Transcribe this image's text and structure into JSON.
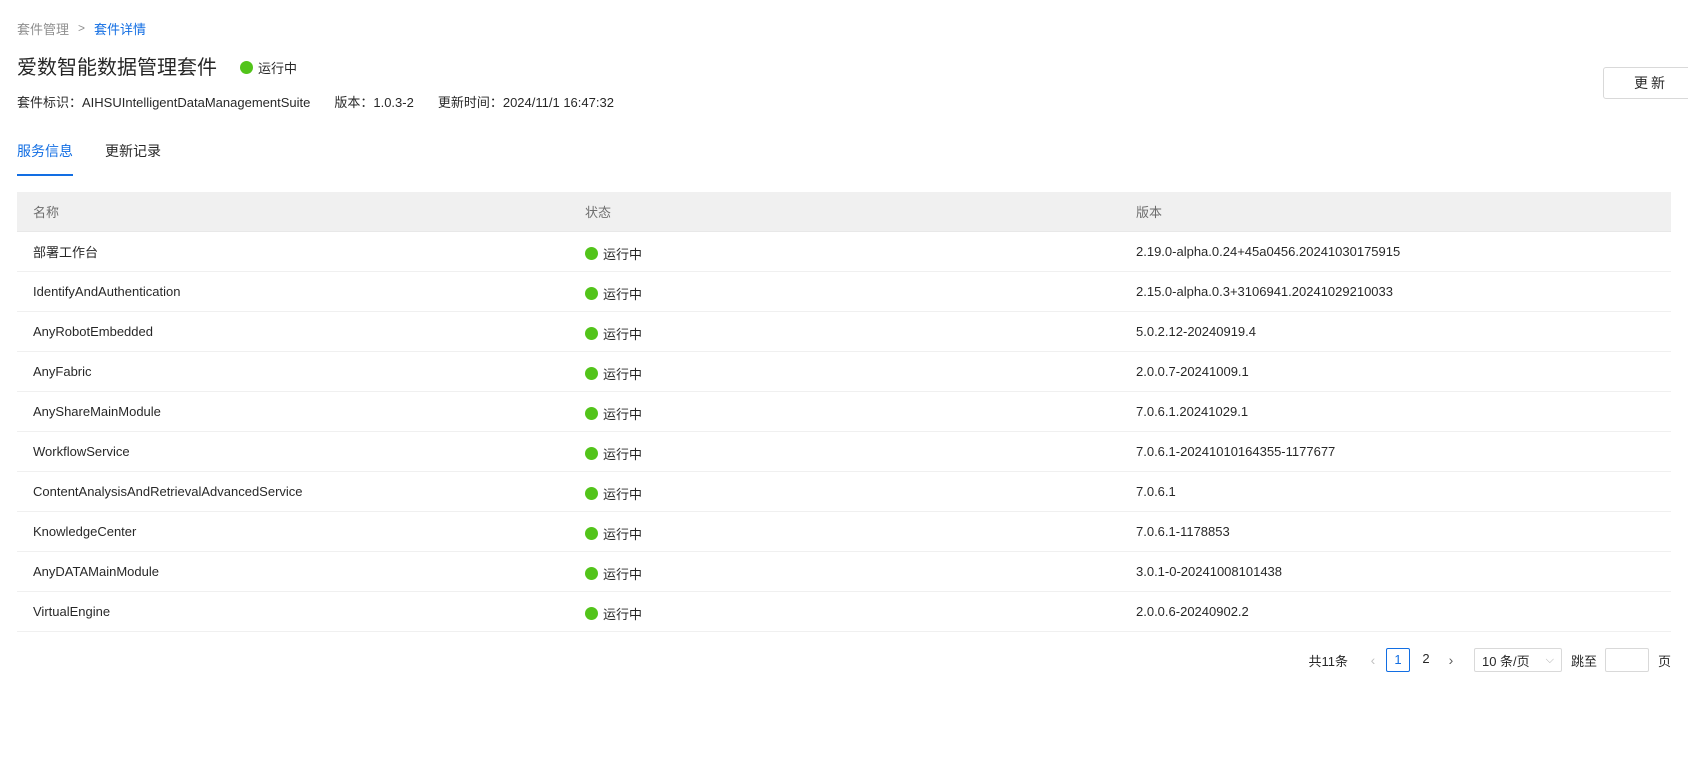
{
  "breadcrumb": {
    "parent": "套件管理",
    "separator": ">",
    "current": "套件详情"
  },
  "suite": {
    "title": "爱数智能数据管理套件",
    "status": "运行中",
    "id_label": "套件标识：AIHSUIntelligentDataManagementSuite",
    "version_label": "版本：1.0.3-2",
    "updated_label": "更新时间：2024/11/1 16:47:32"
  },
  "actions": {
    "update": "更新"
  },
  "tabs": [
    {
      "label": "服务信息",
      "active": true
    },
    {
      "label": "更新记录",
      "active": false
    }
  ],
  "table": {
    "columns": [
      "名称",
      "状态",
      "版本"
    ],
    "rows": [
      {
        "name": "部署工作台",
        "status": "运行中",
        "version": "2.19.0-alpha.0.24+45a0456.20241030175915"
      },
      {
        "name": "IdentifyAndAuthentication",
        "status": "运行中",
        "version": "2.15.0-alpha.0.3+3106941.20241029210033"
      },
      {
        "name": "AnyRobotEmbedded",
        "status": "运行中",
        "version": "5.0.2.12-20240919.4"
      },
      {
        "name": "AnyFabric",
        "status": "运行中",
        "version": "2.0.0.7-20241009.1"
      },
      {
        "name": "AnyShareMainModule",
        "status": "运行中",
        "version": "7.0.6.1.20241029.1"
      },
      {
        "name": "WorkflowService",
        "status": "运行中",
        "version": "7.0.6.1-20241010164355-1177677"
      },
      {
        "name": "ContentAnalysisAndRetrievalAdvancedService",
        "status": "运行中",
        "version": "7.0.6.1"
      },
      {
        "name": "KnowledgeCenter",
        "status": "运行中",
        "version": "7.0.6.1-1178853"
      },
      {
        "name": "AnyDATAMainModule",
        "status": "运行中",
        "version": "3.0.1-0-20241008101438"
      },
      {
        "name": "VirtualEngine",
        "status": "运行中",
        "version": "2.0.0.6-20240902.2"
      }
    ]
  },
  "pagination": {
    "total": "共11条",
    "prev_icon": "‹",
    "next_icon": "›",
    "pages": [
      "1",
      "2"
    ],
    "current_page": "1",
    "page_size": "10 条/页",
    "jump_label": "跳至",
    "page_unit": "页"
  },
  "colors": {
    "accent": "#126ee3",
    "running": "#52c41a"
  }
}
